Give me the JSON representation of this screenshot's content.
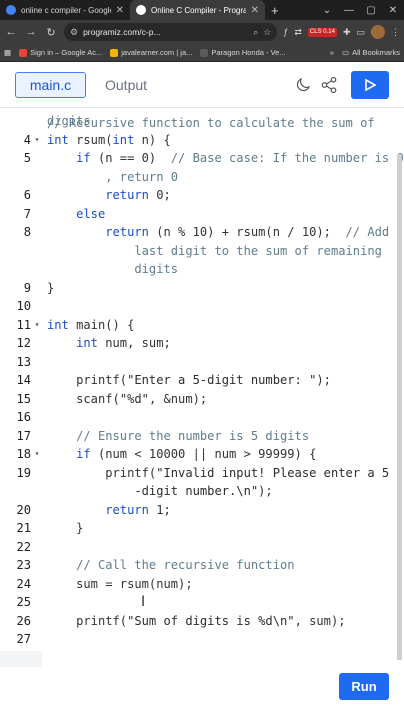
{
  "browser": {
    "tabs": [
      {
        "title": "online c compiler - Google Se",
        "active": false,
        "favicon_color": "#4285f4"
      },
      {
        "title": "Online C Compiler - Programi",
        "active": true,
        "favicon_color": "#ffffff"
      }
    ],
    "new_tab": "+",
    "url": "programiz.com/c-p...",
    "window_controls": [
      "⌄",
      "—",
      "▢",
      "✕"
    ],
    "ext_badge": "CLS 0.14",
    "bookmarks": [
      {
        "label": "Sign in – Google Ac...",
        "color": "#ea4335"
      },
      {
        "label": "javalearner.com | ja...",
        "color": "#f4b400"
      },
      {
        "label": "Paragon Honda - Ve...",
        "color": "#2a2a2a"
      }
    ],
    "all_bookmarks": "All Bookmarks"
  },
  "app": {
    "file_tab": "main.c",
    "output_tab": "Output",
    "run_label": "Run",
    "icons": {
      "theme": "moon-icon",
      "share": "share-icon",
      "run": "play-icon"
    },
    "accent": "#1e6bf1"
  },
  "editor": {
    "partial_top": "// Recursive function to calculate the sum of",
    "lines": [
      {
        "num": "",
        "fold": false,
        "segs": [
          {
            "c": "cm",
            "t": "digits"
          }
        ],
        "wrap": true
      },
      {
        "num": "4",
        "fold": true,
        "segs": [
          {
            "c": "kw",
            "t": "int"
          },
          {
            "c": "",
            "t": " rsum("
          },
          {
            "c": "kw",
            "t": "int"
          },
          {
            "c": "",
            "t": " n) {"
          }
        ]
      },
      {
        "num": "5",
        "fold": false,
        "segs": [
          {
            "c": "",
            "t": "    "
          },
          {
            "c": "kw",
            "t": "if"
          },
          {
            "c": "",
            "t": " (n == 0)  "
          },
          {
            "c": "cm",
            "t": "// Base case: If the number is 0"
          }
        ]
      },
      {
        "num": "",
        "fold": false,
        "segs": [
          {
            "c": "cm",
            "t": "        , return 0"
          }
        ]
      },
      {
        "num": "6",
        "fold": false,
        "segs": [
          {
            "c": "",
            "t": "        "
          },
          {
            "c": "kw",
            "t": "return"
          },
          {
            "c": "",
            "t": " 0;"
          }
        ]
      },
      {
        "num": "7",
        "fold": false,
        "segs": [
          {
            "c": "",
            "t": "    "
          },
          {
            "c": "kw",
            "t": "else"
          }
        ]
      },
      {
        "num": "8",
        "fold": false,
        "segs": [
          {
            "c": "",
            "t": "        "
          },
          {
            "c": "kw",
            "t": "return"
          },
          {
            "c": "",
            "t": " (n % 10) + rsum(n / 10);  "
          },
          {
            "c": "cm",
            "t": "// Add"
          }
        ]
      },
      {
        "num": "",
        "fold": false,
        "segs": [
          {
            "c": "cm",
            "t": "            last digit to the sum of remaining"
          }
        ]
      },
      {
        "num": "",
        "fold": false,
        "segs": [
          {
            "c": "cm",
            "t": "            digits"
          }
        ]
      },
      {
        "num": "9",
        "fold": false,
        "segs": [
          {
            "c": "",
            "t": "}"
          }
        ]
      },
      {
        "num": "10",
        "fold": false,
        "segs": []
      },
      {
        "num": "11",
        "fold": true,
        "segs": [
          {
            "c": "kw",
            "t": "int"
          },
          {
            "c": "",
            "t": " main() {"
          }
        ]
      },
      {
        "num": "12",
        "fold": false,
        "segs": [
          {
            "c": "",
            "t": "    "
          },
          {
            "c": "kw",
            "t": "int"
          },
          {
            "c": "",
            "t": " num, sum;"
          }
        ]
      },
      {
        "num": "13",
        "fold": false,
        "segs": []
      },
      {
        "num": "14",
        "fold": false,
        "segs": [
          {
            "c": "",
            "t": "    printf("
          },
          {
            "c": "st",
            "t": "\"Enter a 5-digit number: \""
          },
          {
            "c": "",
            "t": ");"
          }
        ]
      },
      {
        "num": "15",
        "fold": false,
        "segs": [
          {
            "c": "",
            "t": "    scanf("
          },
          {
            "c": "st",
            "t": "\"%d\""
          },
          {
            "c": "",
            "t": ", &num);"
          }
        ]
      },
      {
        "num": "16",
        "fold": false,
        "segs": []
      },
      {
        "num": "17",
        "fold": false,
        "segs": [
          {
            "c": "",
            "t": "    "
          },
          {
            "c": "cm",
            "t": "// Ensure the number is 5 digits"
          }
        ]
      },
      {
        "num": "18",
        "fold": true,
        "segs": [
          {
            "c": "",
            "t": "    "
          },
          {
            "c": "kw",
            "t": "if"
          },
          {
            "c": "",
            "t": " (num < 10000 || num > 99999) {"
          }
        ]
      },
      {
        "num": "19",
        "fold": false,
        "segs": [
          {
            "c": "",
            "t": "        printf("
          },
          {
            "c": "st",
            "t": "\"Invalid input! Please enter a 5"
          }
        ]
      },
      {
        "num": "",
        "fold": false,
        "segs": [
          {
            "c": "st",
            "t": "            -digit number.\\n\""
          },
          {
            "c": "",
            "t": ");"
          }
        ]
      },
      {
        "num": "20",
        "fold": false,
        "segs": [
          {
            "c": "",
            "t": "        "
          },
          {
            "c": "kw",
            "t": "return"
          },
          {
            "c": "",
            "t": " 1;"
          }
        ]
      },
      {
        "num": "21",
        "fold": false,
        "segs": [
          {
            "c": "",
            "t": "    }"
          }
        ]
      },
      {
        "num": "22",
        "fold": false,
        "segs": []
      },
      {
        "num": "23",
        "fold": false,
        "segs": [
          {
            "c": "",
            "t": "    "
          },
          {
            "c": "cm",
            "t": "// Call the recursive function"
          }
        ]
      },
      {
        "num": "24",
        "fold": false,
        "segs": [
          {
            "c": "",
            "t": "    sum = rsum(num);"
          }
        ]
      },
      {
        "num": "25",
        "fold": false,
        "segs": []
      },
      {
        "num": "26",
        "fold": false,
        "segs": [
          {
            "c": "",
            "t": "    printf("
          },
          {
            "c": "st",
            "t": "\"Sum of digits is %d\\n\""
          },
          {
            "c": "",
            "t": ", sum);"
          }
        ]
      },
      {
        "num": "27",
        "fold": false,
        "segs": []
      }
    ]
  }
}
